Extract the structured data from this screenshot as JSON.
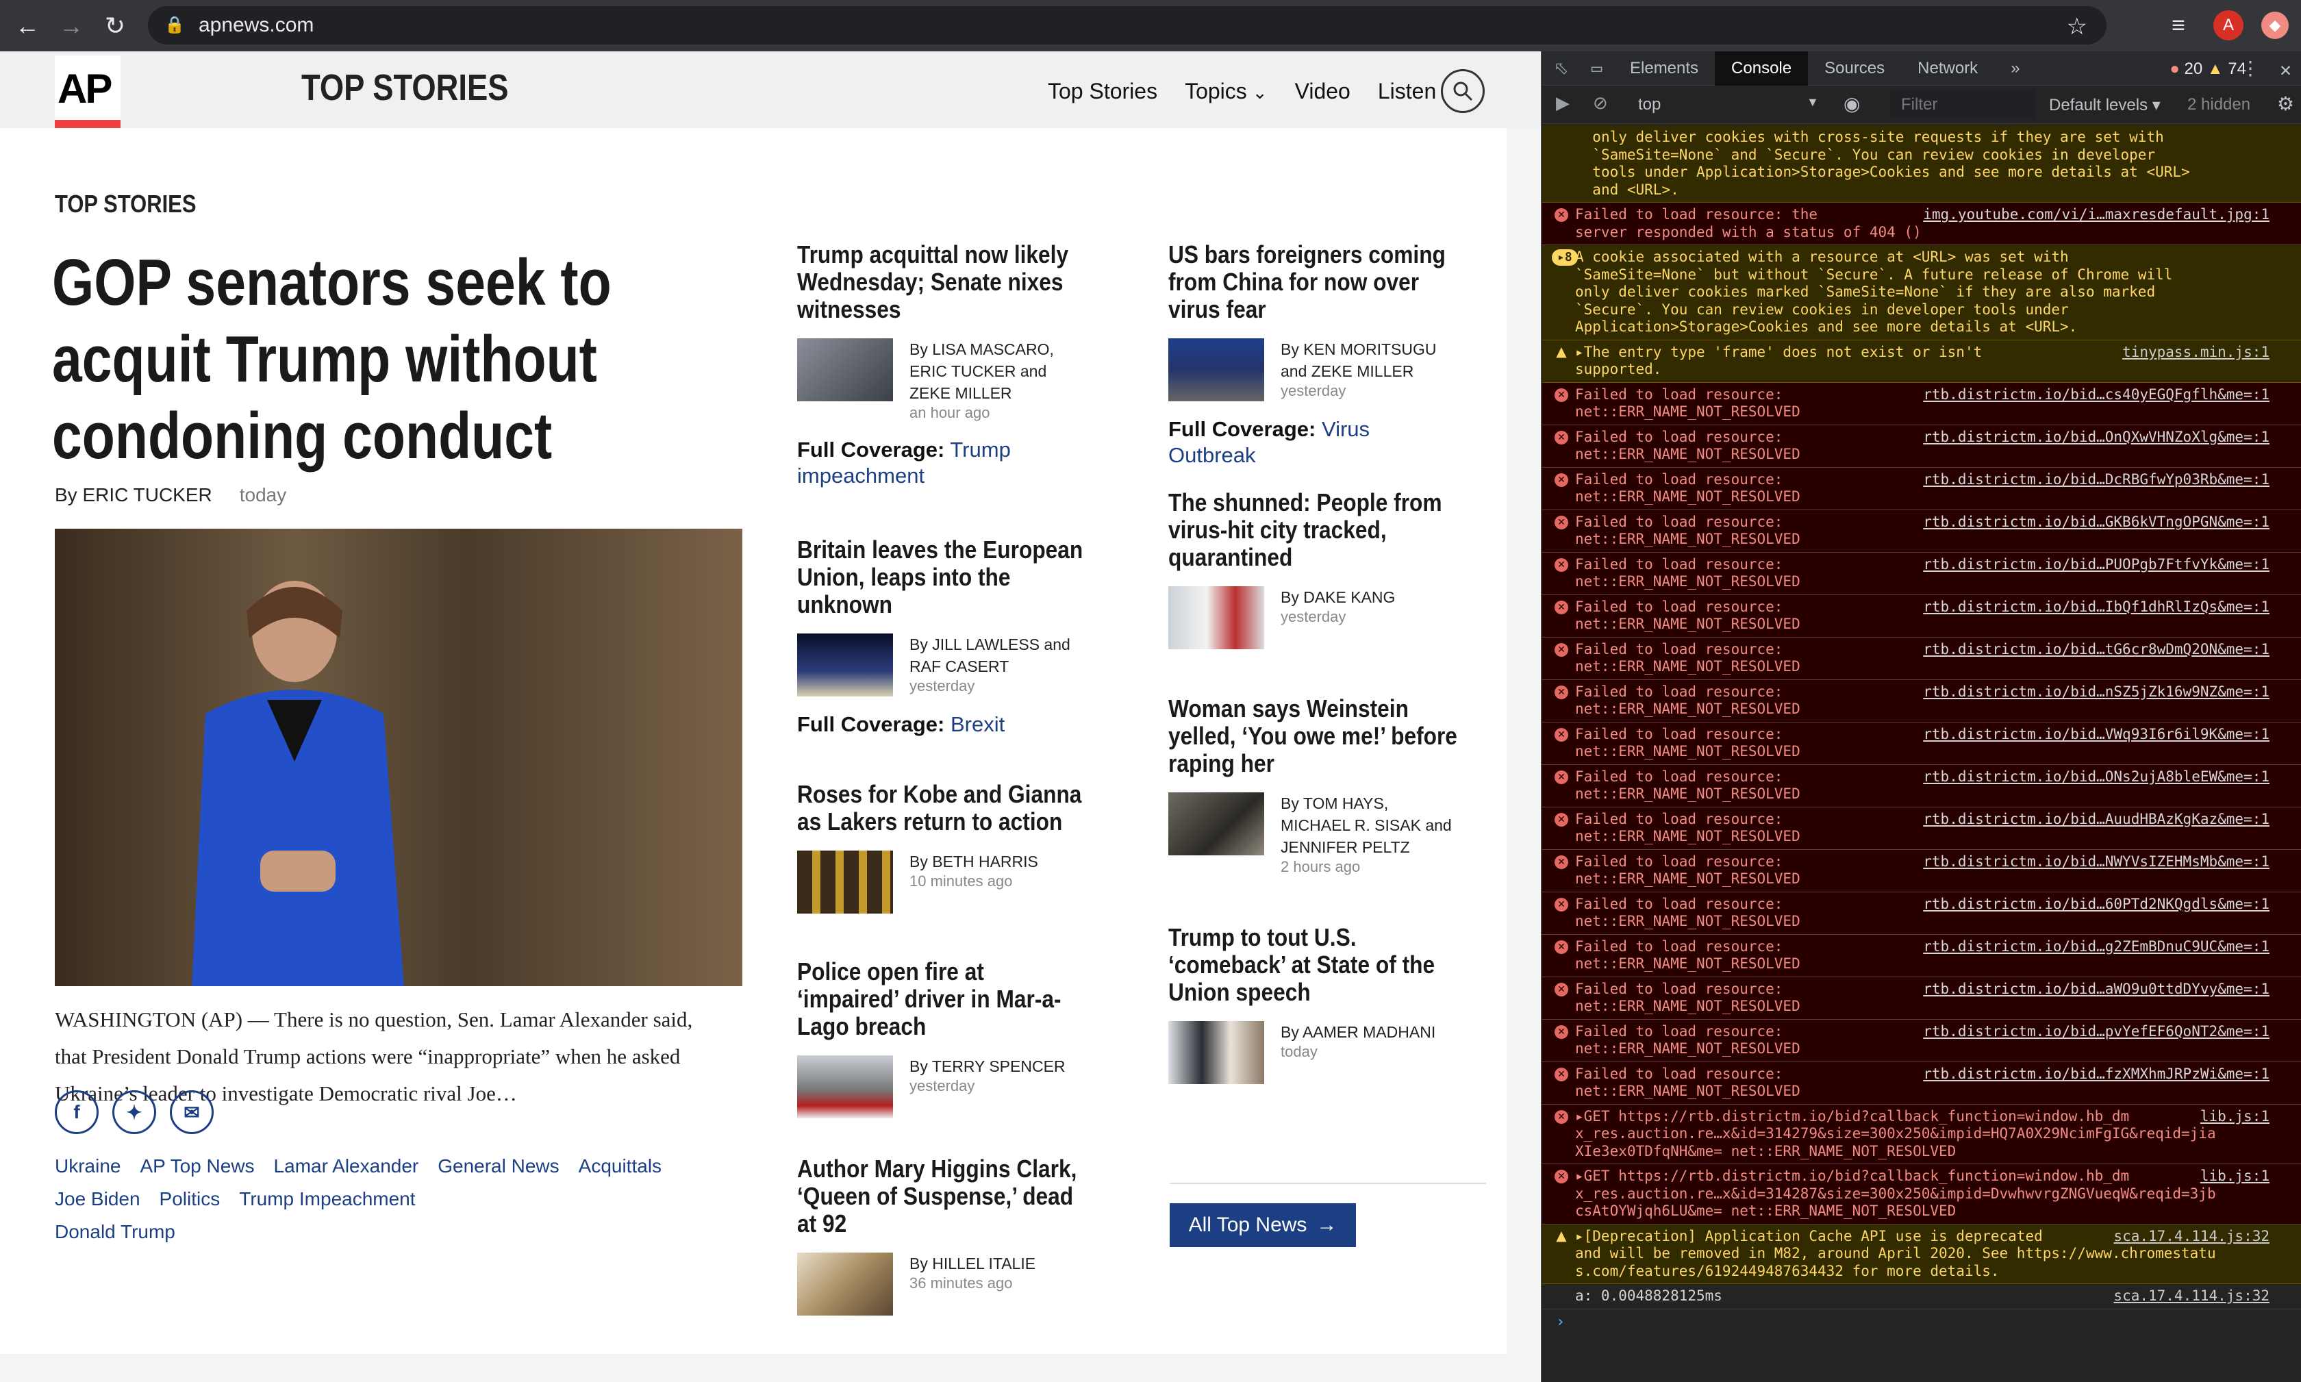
{
  "browser": {
    "url": "apnews.com",
    "profile_initial": "A"
  },
  "site": {
    "logo": "AP",
    "title": "TOP STORIES",
    "nav": [
      "Top Stories",
      "Topics",
      "Video",
      "Listen"
    ]
  },
  "section_label": "TOP STORIES",
  "lead": {
    "headline": "GOP senators seek to acquit Trump without condoning conduct",
    "byline": "By ERIC TUCKER",
    "time": "today",
    "body": "WASHINGTON (AP) — There is no question, Sen. Lamar Alexander said, that President Donald Trump actions were “inappropriate” when he asked Ukraine’s leader to investigate Democratic rival Joe…",
    "tags": [
      "Ukraine",
      "AP Top News",
      "Lamar Alexander",
      "General News",
      "Acquittals",
      "Joe Biden",
      "Politics",
      "Trump Impeachment",
      "Donald Trump"
    ]
  },
  "stories": [
    {
      "headline": "Trump acquittal now likely Wednesday; Senate nixes witnesses",
      "byline": "By LISA MASCARO, ERIC TUCKER and ZEKE MILLER",
      "time": "an hour ago",
      "coverage_label": "Full Coverage:",
      "coverage_link": "Trump impeachment"
    },
    {
      "headline": "Britain leaves the European Union, leaps into the unknown",
      "byline": "By JILL LAWLESS and RAF CASERT",
      "time": "yesterday",
      "coverage_label": "Full Coverage:",
      "coverage_link": "Brexit"
    },
    {
      "headline": "Roses for Kobe and Gianna as Lakers return to action",
      "byline": "By BETH HARRIS",
      "time": "10 minutes ago"
    },
    {
      "headline": "Police open fire at ‘impaired’ driver in Mar-a-Lago breach",
      "byline": "By TERRY SPENCER",
      "time": "yesterday"
    },
    {
      "headline": "Author Mary Higgins Clark, ‘Queen of Suspense,’ dead at 92",
      "byline": "By HILLEL ITALIE",
      "time": "36 minutes ago"
    },
    {
      "headline": "US bars foreigners coming from China for now over virus fear",
      "byline": "By KEN MORITSUGU and ZEKE MILLER",
      "time": "yesterday",
      "coverage_label": "Full Coverage:",
      "coverage_link": "Virus Outbreak"
    },
    {
      "headline": "The shunned: People from virus-hit city tracked, quarantined",
      "byline": "By DAKE KANG",
      "time": "yesterday"
    },
    {
      "headline": "Woman says Weinstein yelled, ‘You owe me!’ before raping her",
      "byline": "By TOM HAYS, MICHAEL R. SISAK and JENNIFER PELTZ",
      "time": "2 hours ago"
    },
    {
      "headline": "Trump to tout U.S. ‘comeback’ at State of the Union speech",
      "byline": "By AAMER MADHANI",
      "time": "today"
    }
  ],
  "all_news_label": "All Top News",
  "devtools": {
    "tabs": [
      "Elements",
      "Console",
      "Sources",
      "Network"
    ],
    "active_tab": "Console",
    "error_count": "20",
    "warning_count": "74",
    "context": "top",
    "filter_placeholder": "Filter",
    "levels": "Default levels",
    "hidden": "2 hidden",
    "messages": [
      {
        "level": "warn",
        "text": "  only deliver cookies with cross-site requests if they are set with\n  `SameSite=None` and `Secure`. You can review cookies in developer\n  tools under Application>Storage>Cookies and see more details at <URL>\n  and <URL>.",
        "src": ""
      },
      {
        "level": "error",
        "text": "Failed to load resource: the\nserver responded with a status of 404 ()",
        "src": "img.youtube.com/vi/i…maxresdefault.jpg:1"
      },
      {
        "level": "warn",
        "badge": "8",
        "text": "A cookie associated with a resource at <URL> was set with\n`SameSite=None` but without `Secure`. A future release of Chrome will\nonly deliver cookies marked `SameSite=None` if they are also marked\n`Secure`. You can review cookies in developer tools under\nApplication>Storage>Cookies and see more details at <URL>.",
        "src": ""
      },
      {
        "level": "warn",
        "text": "▸The entry type 'frame' does not exist or isn't\nsupported.",
        "src": "tinypass.min.js:1"
      },
      {
        "level": "error",
        "text": "Failed to load resource:\nnet::ERR_NAME_NOT_RESOLVED",
        "src": "rtb.districtm.io/bid…cs40yEGQFgflh&me=:1"
      },
      {
        "level": "error",
        "text": "Failed to load resource:\nnet::ERR_NAME_NOT_RESOLVED",
        "src": "rtb.districtm.io/bid…OnQXwVHNZoXlg&me=:1"
      },
      {
        "level": "error",
        "text": "Failed to load resource:\nnet::ERR_NAME_NOT_RESOLVED",
        "src": "rtb.districtm.io/bid…DcRBGfwYp03Rb&me=:1"
      },
      {
        "level": "error",
        "text": "Failed to load resource:\nnet::ERR_NAME_NOT_RESOLVED",
        "src": "rtb.districtm.io/bid…GKB6kVTngOPGN&me=:1"
      },
      {
        "level": "error",
        "text": "Failed to load resource:\nnet::ERR_NAME_NOT_RESOLVED",
        "src": "rtb.districtm.io/bid…PUOPgb7FtfvYk&me=:1"
      },
      {
        "level": "error",
        "text": "Failed to load resource:\nnet::ERR_NAME_NOT_RESOLVED",
        "src": "rtb.districtm.io/bid…IbQf1dhRlIzQs&me=:1"
      },
      {
        "level": "error",
        "text": "Failed to load resource:\nnet::ERR_NAME_NOT_RESOLVED",
        "src": "rtb.districtm.io/bid…tG6cr8wDmQ2ON&me=:1"
      },
      {
        "level": "error",
        "text": "Failed to load resource:\nnet::ERR_NAME_NOT_RESOLVED",
        "src": "rtb.districtm.io/bid…nSZ5jZk16w9NZ&me=:1"
      },
      {
        "level": "error",
        "text": "Failed to load resource:\nnet::ERR_NAME_NOT_RESOLVED",
        "src": "rtb.districtm.io/bid…VWq93I6r6il9K&me=:1"
      },
      {
        "level": "error",
        "text": "Failed to load resource:\nnet::ERR_NAME_NOT_RESOLVED",
        "src": "rtb.districtm.io/bid…ONs2ujA8bleEW&me=:1"
      },
      {
        "level": "error",
        "text": "Failed to load resource:\nnet::ERR_NAME_NOT_RESOLVED",
        "src": "rtb.districtm.io/bid…AuudHBAzKgKaz&me=:1"
      },
      {
        "level": "error",
        "text": "Failed to load resource:\nnet::ERR_NAME_NOT_RESOLVED",
        "src": "rtb.districtm.io/bid…NWYVsIZEHMsMb&me=:1"
      },
      {
        "level": "error",
        "text": "Failed to load resource:\nnet::ERR_NAME_NOT_RESOLVED",
        "src": "rtb.districtm.io/bid…60PTd2NKQgdls&me=:1"
      },
      {
        "level": "error",
        "text": "Failed to load resource:\nnet::ERR_NAME_NOT_RESOLVED",
        "src": "rtb.districtm.io/bid…g2ZEmBDnuC9UC&me=:1"
      },
      {
        "level": "error",
        "text": "Failed to load resource:\nnet::ERR_NAME_NOT_RESOLVED",
        "src": "rtb.districtm.io/bid…aWO9u0ttdDYvy&me=:1"
      },
      {
        "level": "error",
        "text": "Failed to load resource:\nnet::ERR_NAME_NOT_RESOLVED",
        "src": "rtb.districtm.io/bid…pvYefEF6QoNT2&me=:1"
      },
      {
        "level": "error",
        "text": "Failed to load resource:\nnet::ERR_NAME_NOT_RESOLVED",
        "src": "rtb.districtm.io/bid…fzXMXhmJRPzWi&me=:1"
      },
      {
        "level": "error",
        "text": "▸GET https://rtb.districtm.io/bid?callback_function=window.hb_dm\nx_res.auction.re…x&id=314279&size=300x250&impid=HQ7A0X29NcimFgIG&reqid=jia\nXIe3ex0TDfqNH&me= net::ERR_NAME_NOT_RESOLVED",
        "src": "lib.js:1"
      },
      {
        "level": "error",
        "text": "▸GET https://rtb.districtm.io/bid?callback_function=window.hb_dm\nx_res.auction.re…x&id=314287&size=300x250&impid=DvwhwvrgZNGVueqW&reqid=3jb\ncsAtOYWjqh6LU&me= net::ERR_NAME_NOT_RESOLVED",
        "src": "lib.js:1"
      },
      {
        "level": "warn",
        "text": "▸[Deprecation] Application Cache API use is deprecated\nand will be removed in M82, around April 2020. See https://www.chromestatu\ns.com/features/6192449487634432 for more details.",
        "src": "sca.17.4.114.js:32"
      },
      {
        "level": "plain",
        "text": "a: 0.0048828125ms",
        "src": "sca.17.4.114.js:32"
      }
    ]
  }
}
